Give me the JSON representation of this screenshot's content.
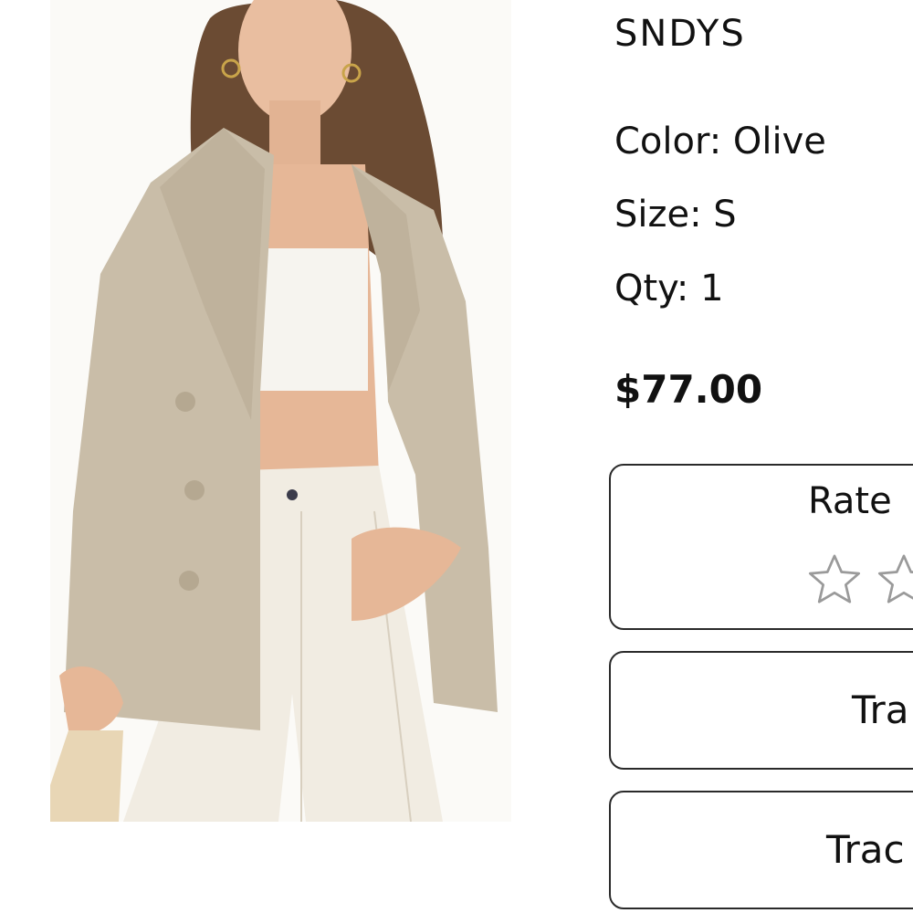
{
  "product": {
    "brand": "SNDYS",
    "color_label": "Color: Olive",
    "size_label": "Size: S",
    "qty_label": "Qty: 1",
    "price": "$77.00",
    "image_description_icon": "product-photo"
  },
  "rating": {
    "title": "Rate",
    "stars_visible": 2,
    "selected": 0,
    "star_color": "#9a9a9a"
  },
  "actions": {
    "track_primary_label": "Tra",
    "track_secondary_label": "Trac"
  },
  "colors": {
    "border": "#2a2a2a",
    "text": "#111111",
    "blazer": "#c9bda8",
    "pants": "#f1ece2"
  }
}
